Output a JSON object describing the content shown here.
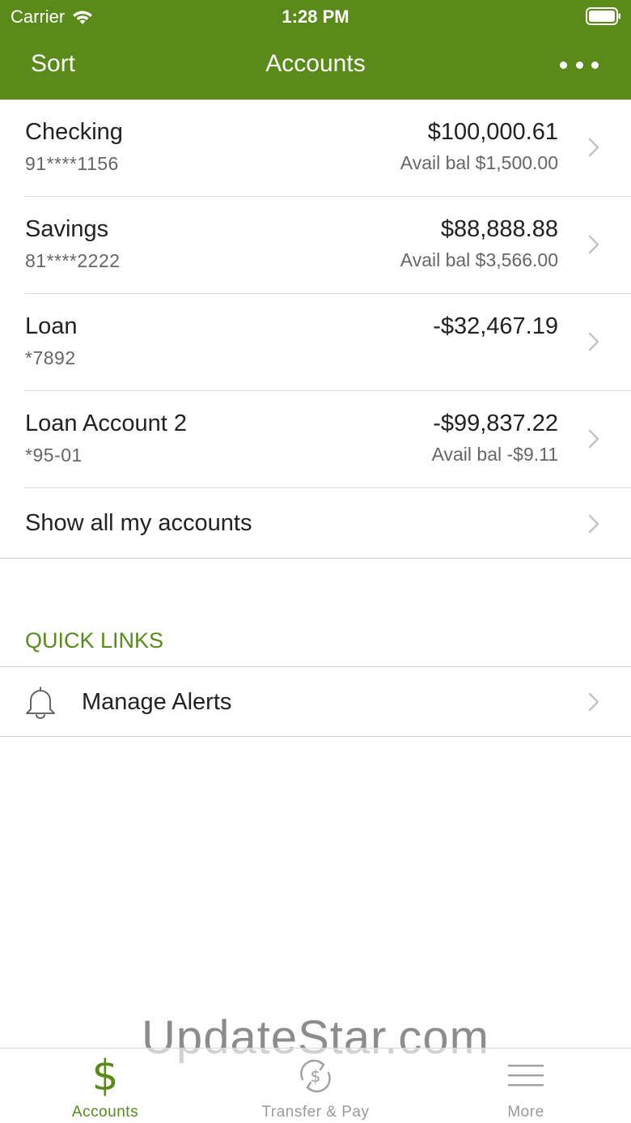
{
  "status_bar": {
    "carrier": "Carrier",
    "time": "1:28 PM"
  },
  "nav": {
    "sort_label": "Sort",
    "title": "Accounts"
  },
  "accounts": [
    {
      "name": "Checking",
      "number": "91****1156",
      "balance": "$100,000.61",
      "avail": "Avail bal $1,500.00"
    },
    {
      "name": "Savings",
      "number": "81****2222",
      "balance": "$88,888.88",
      "avail": "Avail bal $3,566.00"
    },
    {
      "name": "Loan",
      "number": "*7892",
      "balance": "-$32,467.19",
      "avail": ""
    },
    {
      "name": "Loan Account 2",
      "number": "*95-01",
      "balance": "-$99,837.22",
      "avail": "Avail bal -$9.11"
    }
  ],
  "show_all_label": "Show all my accounts",
  "quick_links": {
    "heading": "QUICK LINKS",
    "items": [
      {
        "label": "Manage Alerts",
        "icon": "bell-icon"
      }
    ]
  },
  "watermark": "UpdateStar.com",
  "tabbar": {
    "tabs": [
      {
        "label": "Accounts",
        "icon": "dollar-icon",
        "active": true
      },
      {
        "label": "Transfer & Pay",
        "icon": "transfer-pay-icon",
        "active": false
      },
      {
        "label": "More",
        "icon": "menu-icon",
        "active": false
      }
    ]
  },
  "colors": {
    "brand_green": "#5a8a1a",
    "text_primary": "#222222",
    "text_secondary": "#666666",
    "inactive_tab": "#9a9a9a"
  }
}
